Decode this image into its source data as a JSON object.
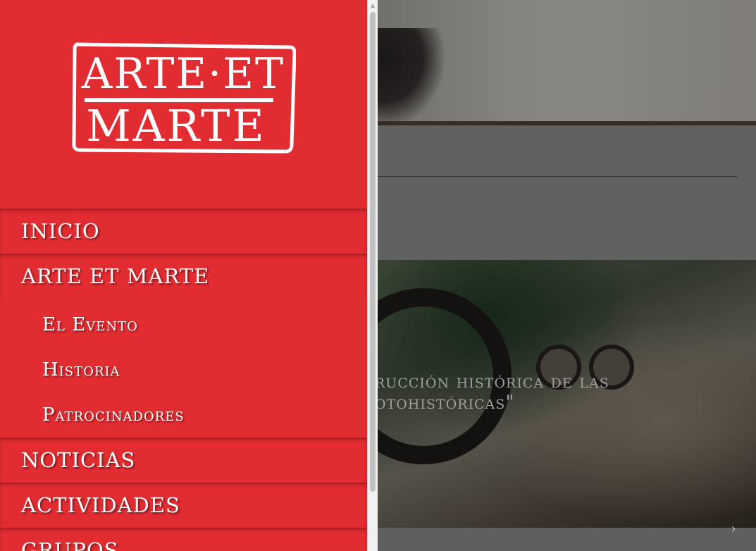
{
  "logo": {
    "line1": "ARTE·ET",
    "line2": "MARTE"
  },
  "menu": {
    "items": [
      {
        "label": "inicio",
        "level": 1
      },
      {
        "label": "arte et marte",
        "level": 1
      },
      {
        "label": "El Evento",
        "level": 2
      },
      {
        "label": "Historia",
        "level": 2
      },
      {
        "label": "Patrocinadores",
        "level": 2
      },
      {
        "label": "noticias",
        "level": 1
      },
      {
        "label": "actividades",
        "level": 1
      },
      {
        "label": "grupos",
        "level": 1
      }
    ]
  },
  "background": {
    "article_title_line1": "rucción histórica de las",
    "article_title_line2": "otohistóricas\""
  },
  "colors": {
    "menu_bg": "#e12c31",
    "menu_text": "#ffffff",
    "scrollbar_thumb": "#c1c1c1"
  },
  "icons": {
    "next_arrow": "chevron-right-icon",
    "scroll_up": "scroll-up-arrow-icon"
  }
}
